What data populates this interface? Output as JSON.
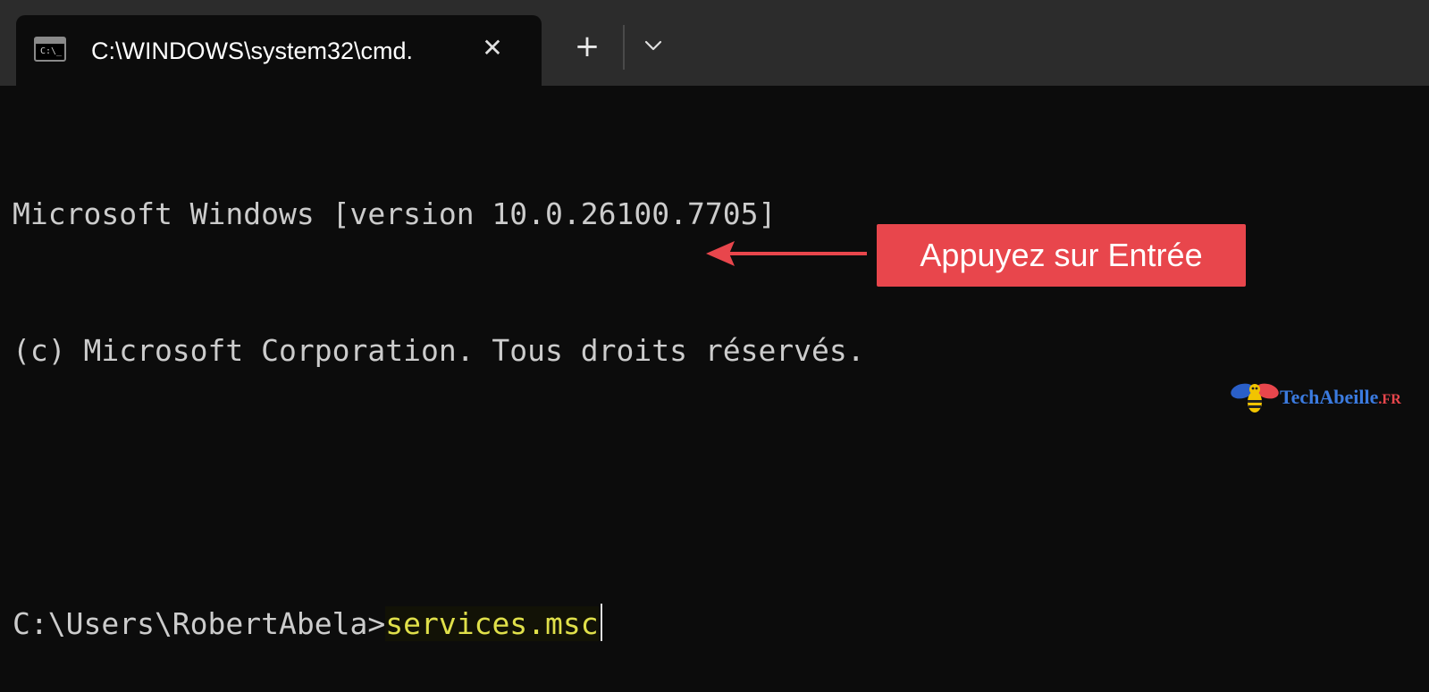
{
  "window": {
    "tab": {
      "title": "C:\\WINDOWS\\system32\\cmd.",
      "icon": "command-prompt-icon",
      "close_glyph": "✕"
    },
    "new_tab_glyph": "+",
    "dropdown_icon": "chevron-down-icon"
  },
  "terminal": {
    "lines": [
      "Microsoft Windows [version 10.0.26100.7705]",
      "(c) Microsoft Corporation. Tous droits réservés.",
      ""
    ],
    "prompt": "C:\\Users\\RobertAbela>",
    "command": "services.msc",
    "text_color": "#cccccc",
    "command_color": "#e0e04a"
  },
  "annotation": {
    "label": "Appuyez sur Entrée",
    "color": "#e8464c"
  },
  "watermark": {
    "brand": "TechAbeille",
    "suffix": ".FR"
  }
}
